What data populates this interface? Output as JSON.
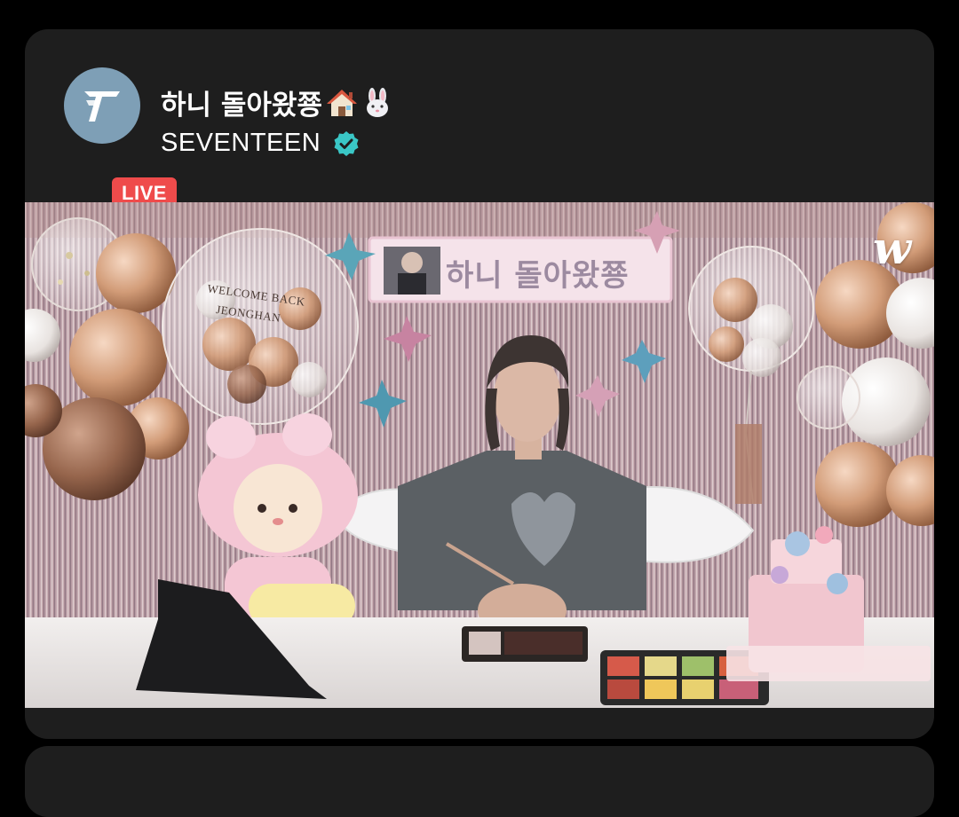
{
  "stream": {
    "live_badge": "LIVE",
    "title": "하니 돌아왔쭁",
    "title_emoji": [
      "house-icon",
      "rabbit-icon"
    ],
    "channel": "SEVENTEEN",
    "verified": true
  },
  "video": {
    "watermark": "w",
    "banner_text": "하니 돌아왔쭁",
    "balloon_line1": "WELCOME BACK",
    "balloon_line2": "JEONGHAN"
  },
  "colors": {
    "live": "#ef4b4b",
    "verified": "#3ac7c6",
    "card": "#1e1e1e"
  }
}
